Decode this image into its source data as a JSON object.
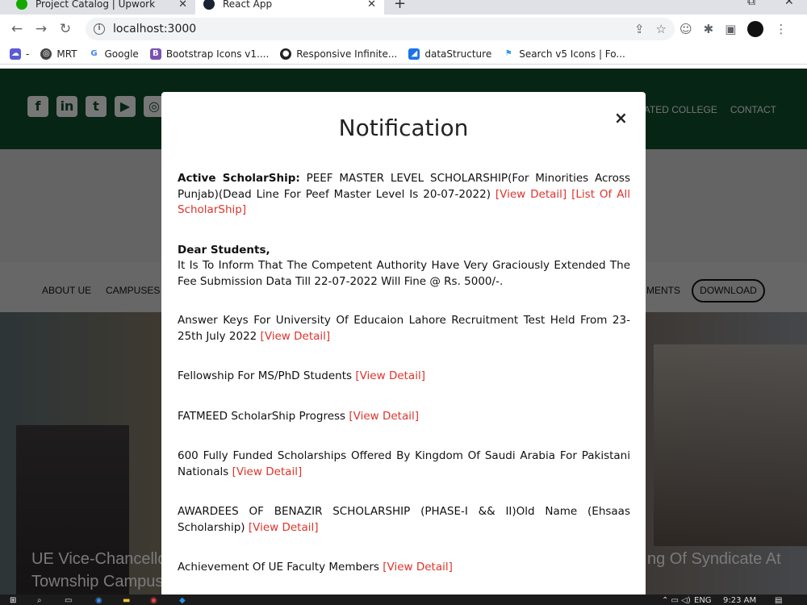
{
  "browser": {
    "tabs": [
      {
        "title": "Project Catalog | Upwork",
        "icon_color": "#14a800",
        "active": false
      },
      {
        "title": "React App",
        "icon_color": "#1a2233",
        "active": true
      }
    ],
    "address": "localhost:3000",
    "bookmarks": [
      {
        "label": "-",
        "icon": "cloud-icon",
        "color": "#5b5bd6"
      },
      {
        "label": "MRT",
        "icon": "globe-icon",
        "color": "#444444"
      },
      {
        "label": "Google",
        "icon": "google-icon",
        "color": "#4285f4"
      },
      {
        "label": "Bootstrap Icons v1....",
        "icon": "bootstrap-icon",
        "color": "#7952b3"
      },
      {
        "label": "Responsive Infinite...",
        "icon": "github-icon",
        "color": "#222222"
      },
      {
        "label": "dataStructure",
        "icon": "chart-icon",
        "color": "#1a73e8"
      },
      {
        "label": "Search v5 Icons | Fo...",
        "icon": "flag-icon",
        "color": "#339af0"
      }
    ]
  },
  "site": {
    "header_nav": [
      "ATED COLLEGE",
      "CONTACT"
    ],
    "menu": {
      "about": "ABOUT UE",
      "campuses": "CAMPUSES",
      "ments": "MENTS",
      "download": "DOWNLOAD"
    },
    "hero_caption_left_1": "UE Vice-Chancello",
    "hero_caption_left_2": "Township Campus",
    "hero_caption_right": "ng Of Syndicate At",
    "colors": {
      "header_green": "#0e4a2b",
      "link_red": "#e0332b"
    }
  },
  "modal": {
    "title": "Notification",
    "close_label": "×",
    "notes": [
      {
        "lead": "Active ScholarShip:",
        "text": " PEEF MASTER LEVEL SCHOLARSHIP(For Minorities Across Punjab)(Dead Line For Peef Master Level Is 20-07-2022) ",
        "links": [
          "[View Detail]",
          "[List Of All ScholarShip]"
        ]
      },
      {
        "lead": "Dear Students,",
        "text": "It Is To Inform That The Competent Authority Have Very Graciously Extended The Fee Submission Data Till 22-07-2022 Will Fine @ Rs. 5000/-.",
        "links": []
      },
      {
        "lead": "",
        "text": "Answer Keys For University Of Educaion Lahore Recruitment Test Held From 23-25th July 2022 ",
        "links": [
          "[View Detail]"
        ]
      },
      {
        "lead": "",
        "text": "Fellowship For MS/PhD Students ",
        "links": [
          "[View Detail]"
        ]
      },
      {
        "lead": "",
        "text": "FATMEED ScholarShip Progress ",
        "links": [
          "[View Detail]"
        ]
      },
      {
        "lead": "",
        "text": "600 Fully Funded Scholarships Offered By Kingdom Of Saudi Arabia For Pakistani Nationals ",
        "links": [
          "[View Detail]"
        ]
      },
      {
        "lead": "",
        "text": "AWARDEES OF BENAZIR SCHOLARSHIP (PHASE-I && II)Old Name (Ehsaas Scholarship) ",
        "links": [
          "[View Detail]"
        ]
      },
      {
        "lead": "",
        "text": "Achievement Of UE Faculty Members ",
        "links": [
          "[View Detail]"
        ]
      }
    ]
  },
  "taskbar": {
    "lang": "ENG",
    "time": "9:23 AM"
  }
}
